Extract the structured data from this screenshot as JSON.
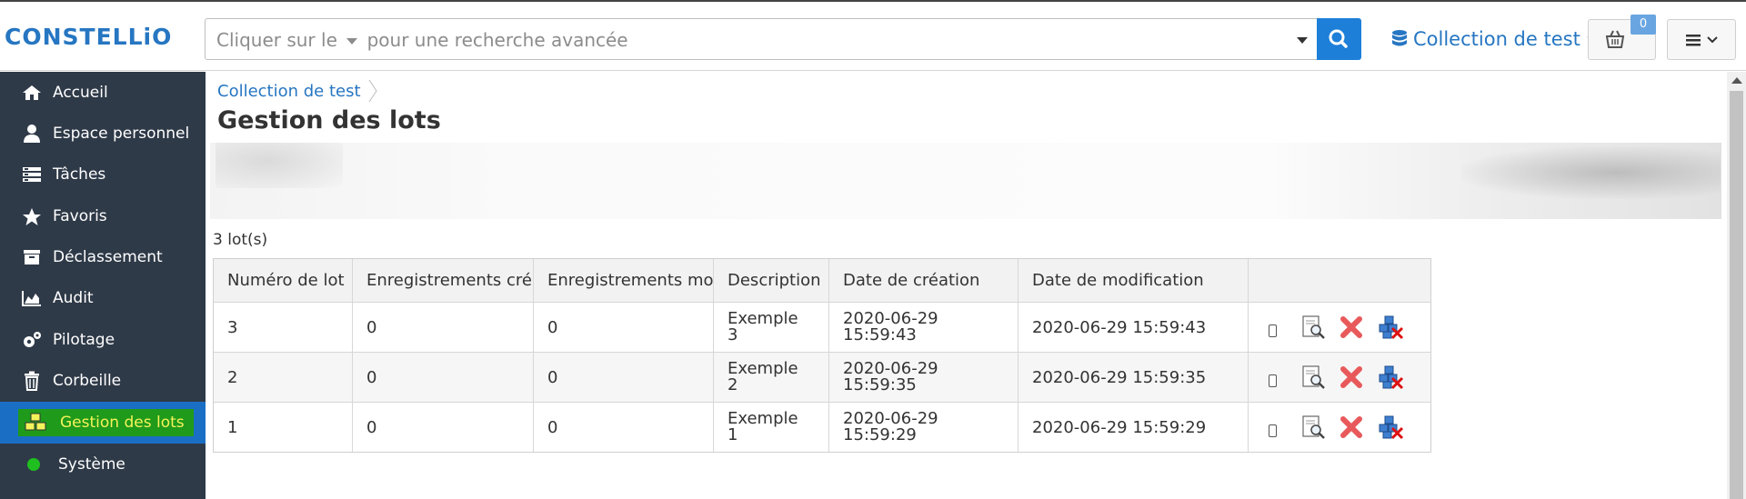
{
  "header": {
    "logo": "CONSTELLiO",
    "search_placeholder_before": "Cliquer sur le",
    "search_placeholder_after": "pour une recherche avancée",
    "collection": "Collection de test",
    "basket_count": "0"
  },
  "sidebar": {
    "items": [
      {
        "label": "Accueil",
        "icon": "home-icon"
      },
      {
        "label": "Espace personnel",
        "icon": "user-icon"
      },
      {
        "label": "Tâches",
        "icon": "tasks-icon"
      },
      {
        "label": "Favoris",
        "icon": "star-icon"
      },
      {
        "label": "Déclassement",
        "icon": "archive-icon"
      },
      {
        "label": "Audit",
        "icon": "area-chart-icon"
      },
      {
        "label": "Pilotage",
        "icon": "gears-icon"
      },
      {
        "label": "Corbeille",
        "icon": "trash-icon"
      },
      {
        "label": "Gestion des lots",
        "icon": "cubes-icon"
      },
      {
        "label": "Système",
        "icon": "status-dot-icon"
      }
    ],
    "active_index": 8
  },
  "main": {
    "breadcrumb": "Collection de test",
    "title": "Gestion des lots",
    "lot_count": "3 lot(s)",
    "table": {
      "headers": [
        "Numéro de lot",
        "Enregistrements créé",
        "Enregistrements moc",
        "Description",
        "Date de création",
        "Date de modification"
      ],
      "rows": [
        {
          "numero": "3",
          "crees": "0",
          "modifies": "0",
          "desc1": "Exemple",
          "desc2": "3",
          "creation1": "2020-06-29",
          "creation2": "15:59:43",
          "modification": "2020-06-29 15:59:43"
        },
        {
          "numero": "2",
          "crees": "0",
          "modifies": "0",
          "desc1": "Exemple",
          "desc2": "2",
          "creation1": "2020-06-29",
          "creation2": "15:59:35",
          "modification": "2020-06-29 15:59:35"
        },
        {
          "numero": "1",
          "crees": "0",
          "modifies": "0",
          "desc1": "Exemple",
          "desc2": "1",
          "creation1": "2020-06-29",
          "creation2": "15:59:29",
          "modification": "2020-06-29 15:59:29"
        }
      ]
    }
  },
  "colors": {
    "brand": "#2676c2",
    "sidebar_bg": "#2f3a48",
    "active_bg": "#1a6fc4",
    "highlight_bg": "#1f9a1a",
    "highlight_text": "#f3f35a",
    "search_button": "#1d7fd8"
  }
}
